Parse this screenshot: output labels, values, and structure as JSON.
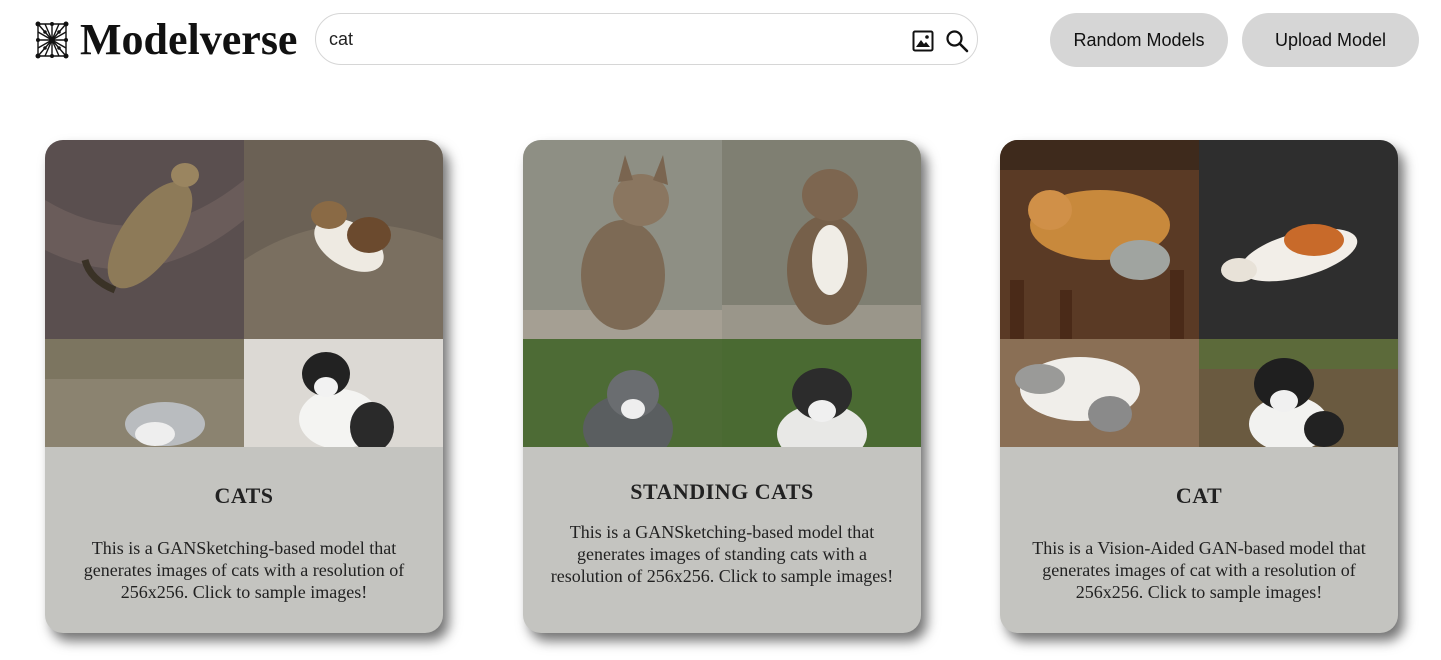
{
  "header": {
    "app_title": "Modelverse",
    "logo_icon": "network-graph-icon",
    "search": {
      "value": "cat",
      "placeholder": ""
    },
    "image_search_icon": "image-icon",
    "search_icon": "magnifier-icon",
    "random_models_label": "Random Models",
    "upload_model_label": "Upload Model"
  },
  "cards": [
    {
      "title": "CATS",
      "description": "This is a GANSketching-based model that generates images of cats with a resolution of 256x256. Click to sample images!"
    },
    {
      "title": "STANDING CATS",
      "description": "This is a GANSketching-based model that generates images of standing cats with a resolution of 256x256. Click to sample images!"
    },
    {
      "title": "CAT",
      "description": "This is a Vision-Aided GAN-based model that generates images of cat with a resolution of 256x256. Click to sample images!"
    }
  ],
  "colors": {
    "button_bg": "#d6d6d6",
    "card_bg": "#c4c4c0",
    "text": "#222222"
  }
}
